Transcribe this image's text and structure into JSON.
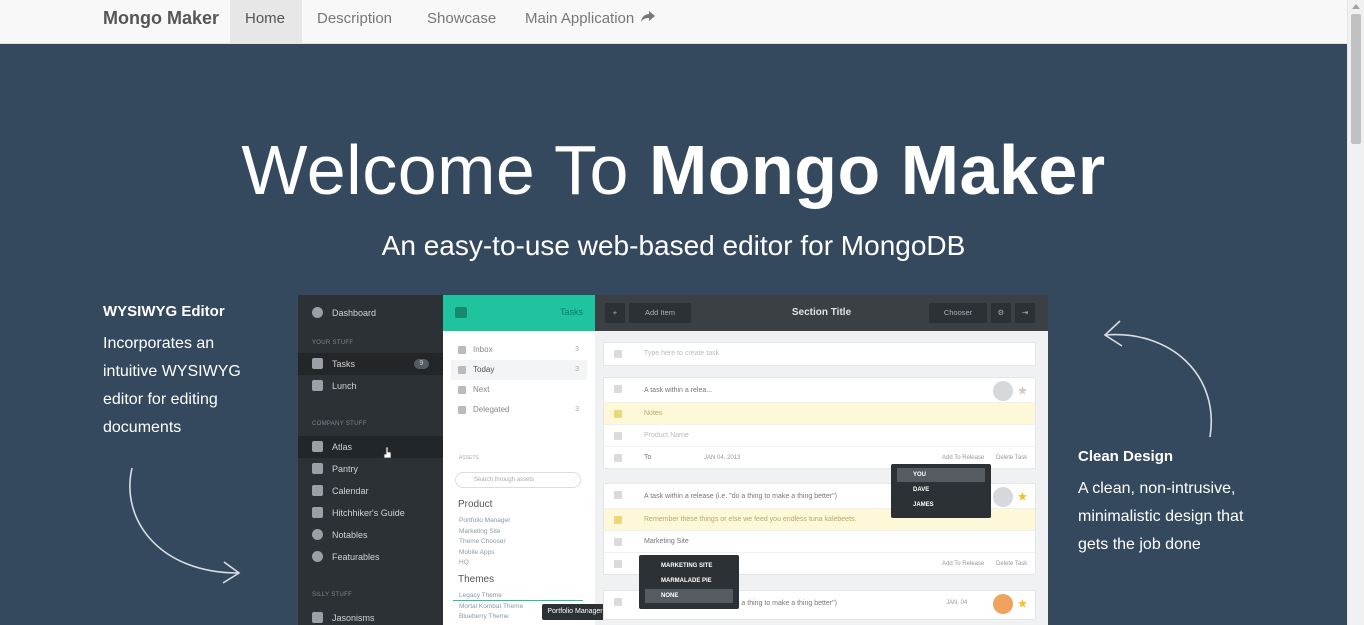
{
  "navbar": {
    "brand": "Mongo Maker",
    "items": [
      {
        "label": "Home",
        "active": true
      },
      {
        "label": "Description",
        "active": false
      },
      {
        "label": "Showcase",
        "active": false
      },
      {
        "label": "Main Application",
        "active": false,
        "icon": "share-icon"
      }
    ]
  },
  "hero": {
    "title_light": "Welcome To ",
    "title_bold": "Mongo Maker",
    "subtitle": "An easy-to-use web-based editor for MongoDB"
  },
  "features": {
    "left": {
      "title": "WYSIWYG Editor",
      "lines": [
        "Incorporates an",
        "intuitive WYSIWYG",
        "editor for editing",
        "documents"
      ]
    },
    "right": {
      "title": "Clean Design",
      "lines": [
        "A clean, non-intrusive,",
        "minimalistic design that",
        "gets the job done"
      ]
    }
  },
  "mock": {
    "sidebar": {
      "dashboard": "Dashboard",
      "sect_your": "YOUR STUFF",
      "tasks": "Tasks",
      "tasks_count": "9",
      "lunch": "Lunch",
      "sect_company": "COMPANY STUFF",
      "atlas": "Atlas",
      "pantry": "Pantry",
      "calendar": "Calendar",
      "guide": "Hitchhiker's Guide",
      "notables": "Notables",
      "featurables": "Featurables",
      "sect_silly": "SILLY STUFF",
      "jasonisms": "Jasonisms"
    },
    "list": {
      "header": "Tasks",
      "items": [
        {
          "label": "Inbox",
          "count": "3"
        },
        {
          "label": "Today",
          "count": "3"
        },
        {
          "label": "Next",
          "count": ""
        },
        {
          "label": "Delegated",
          "count": "3"
        }
      ],
      "assets_label": "ASSETS",
      "search_placeholder": "Search through assets",
      "product_heading": "Product",
      "product_items": [
        "Portfolio Manager",
        "Marketing Site",
        "Theme Chooser",
        "Mobile Apps",
        "HQ"
      ],
      "themes_heading": "Themes",
      "theme_items": [
        "Legacy Theme",
        "Mortal Kombat Theme",
        "Blueberry Theme"
      ],
      "tooltip": "Portfolio Manager"
    },
    "main": {
      "add_item": "Add Item",
      "section_title": "Section Title",
      "chooser": "Chooser",
      "create_placeholder": "Type here to create task",
      "card1": {
        "title": "A task within a relea...",
        "notes": "Notes",
        "product": "Product Name",
        "to": "To",
        "date": "JAN 04, 2013",
        "add_release": "Add To Release",
        "delete": "Delete Task"
      },
      "card2": {
        "title": "A task within a release (i.e. \"do a thing to make a thing better\")",
        "note": "Remember these things or else we feed you endless tuna kalebeets.",
        "site": "Marketing Site",
        "add_release": "Add To Release",
        "delete": "Delete Task"
      },
      "card3": {
        "title": "A task within a release (i.e. \"do a thing to make a thing better\")",
        "date": "JAN. 04"
      },
      "assign_dropdown": [
        "YOU",
        "DAVE",
        "JAMES"
      ],
      "site_dropdown": [
        "MARKETING SITE",
        "MARMALADE PIE",
        "NONE"
      ]
    }
  },
  "colors": {
    "hero_bg": "#34495e",
    "accent_green": "#1fc39e",
    "navbar_bg": "#f8f8f8"
  }
}
